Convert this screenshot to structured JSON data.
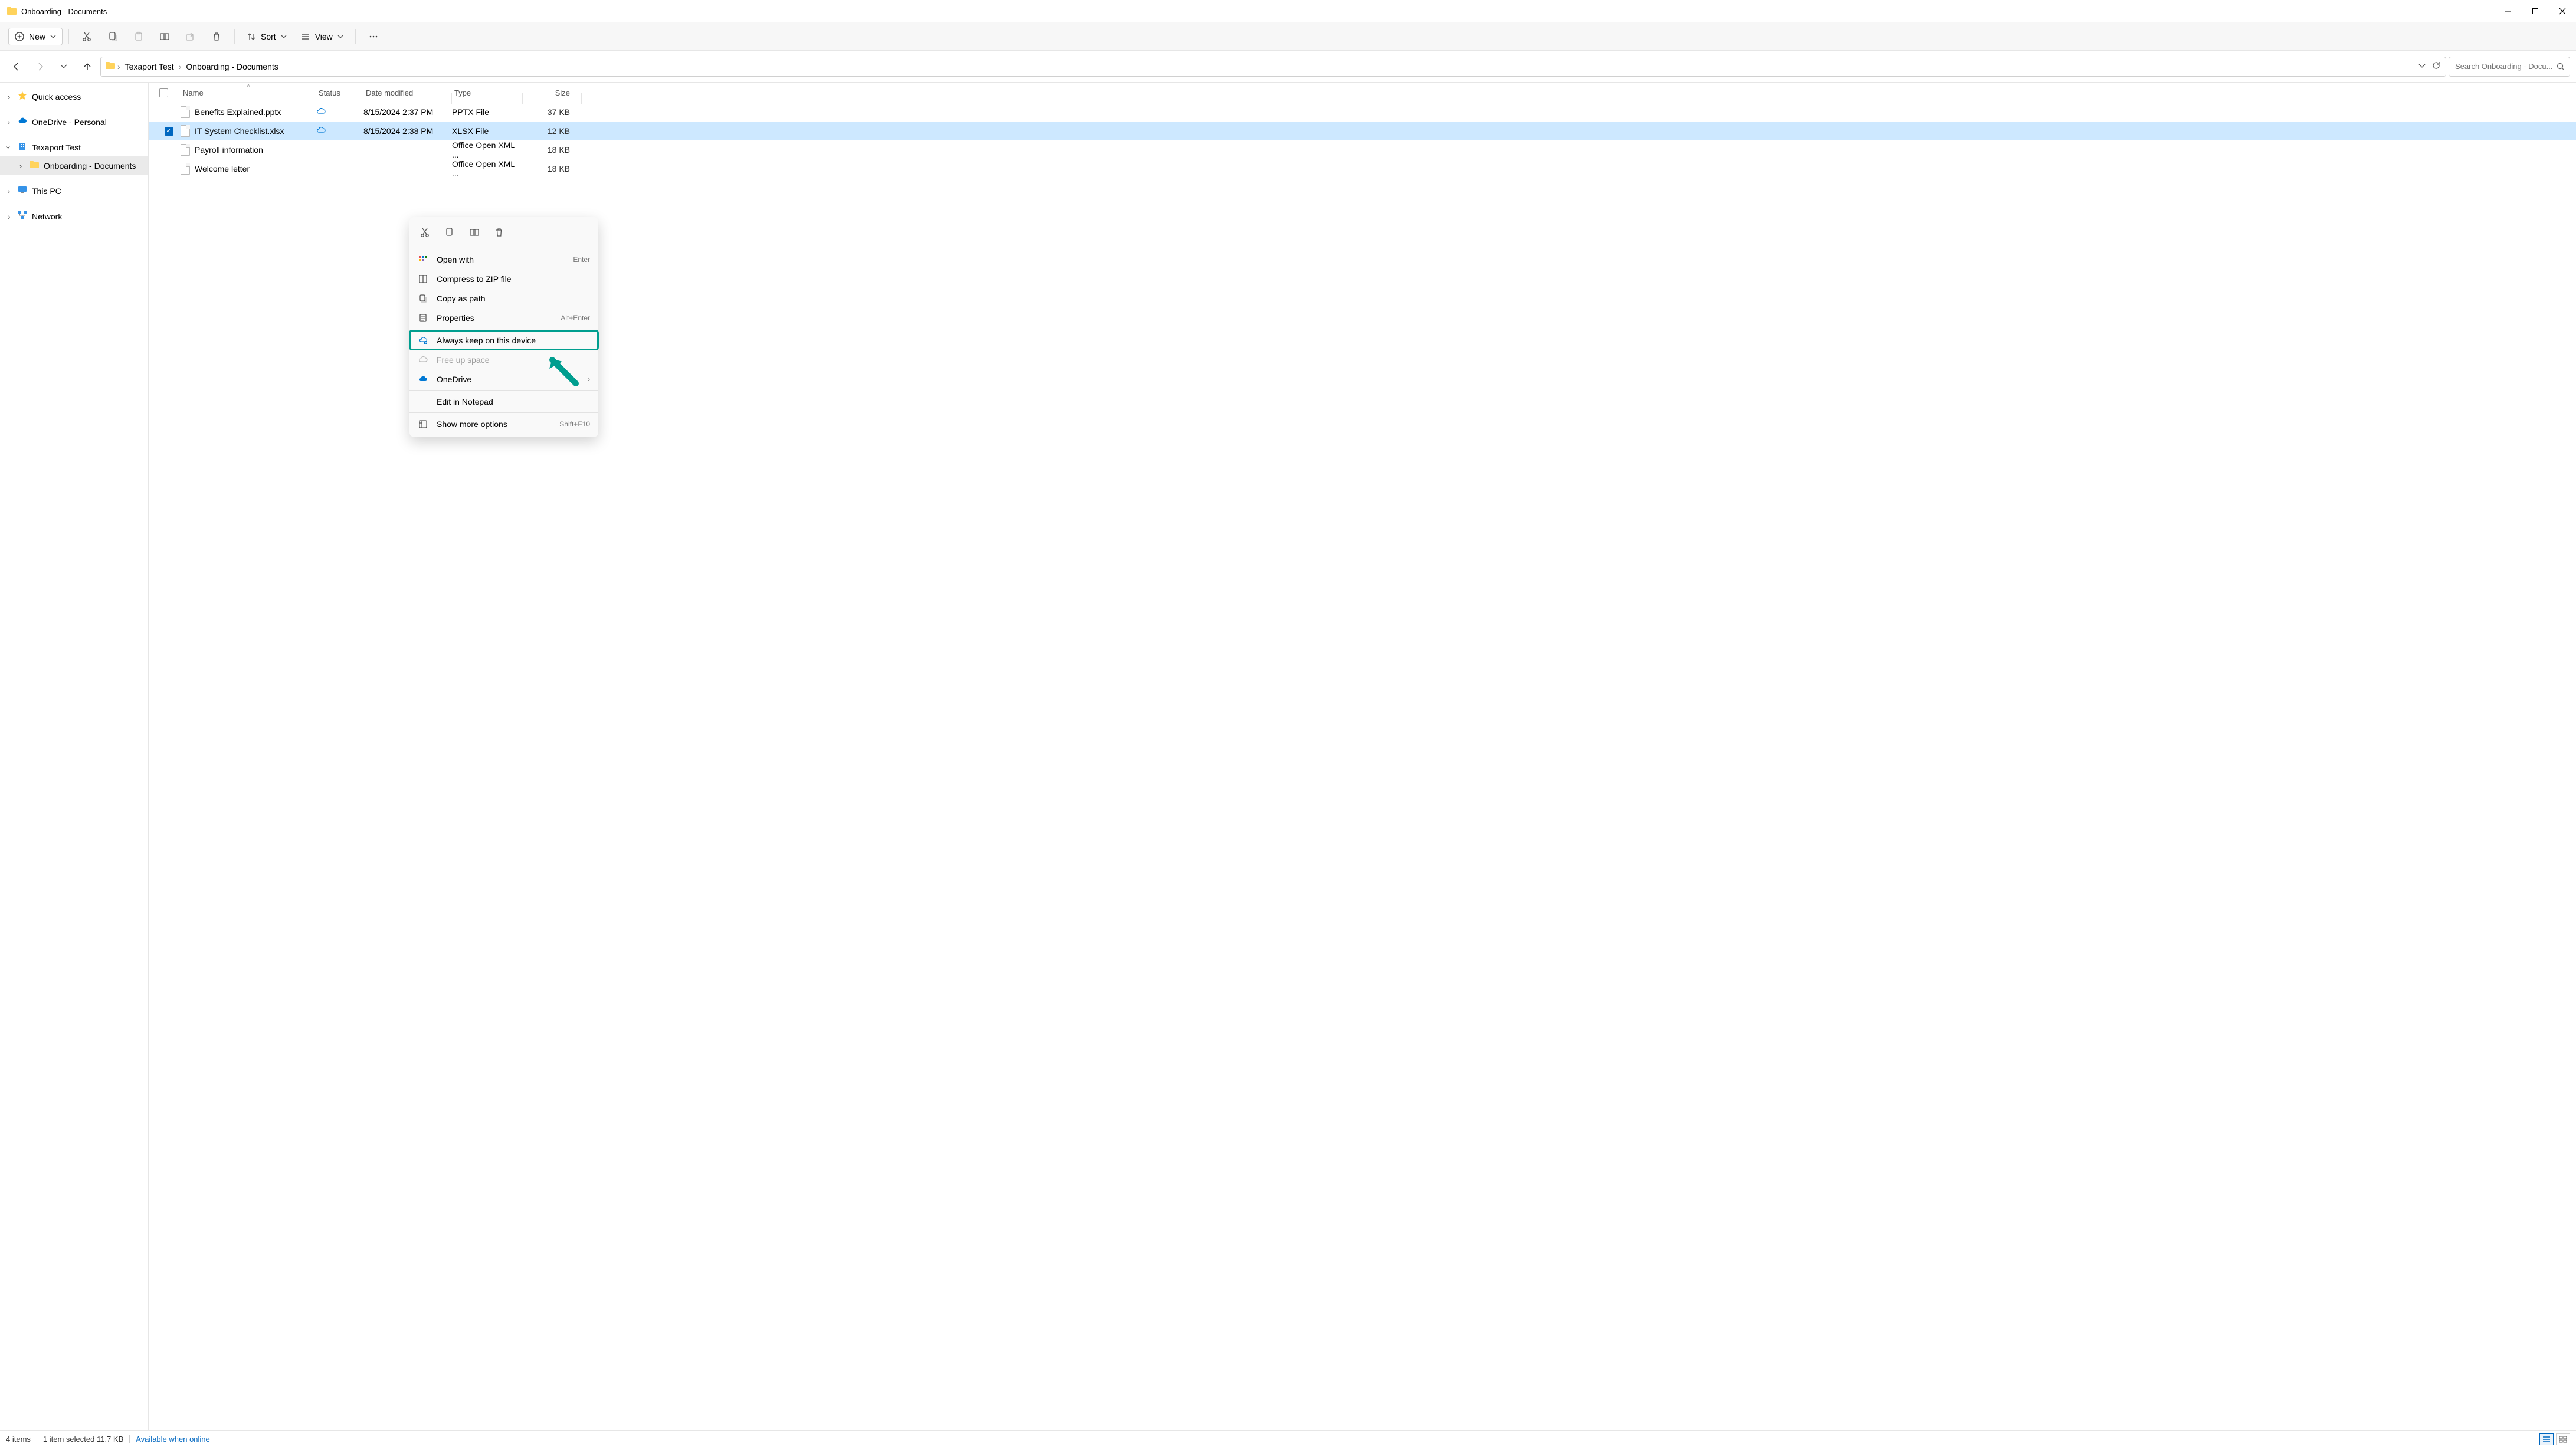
{
  "window": {
    "title": "Onboarding - Documents"
  },
  "toolbar": {
    "new_label": "New",
    "sort_label": "Sort",
    "view_label": "View"
  },
  "breadcrumb": {
    "root": "Texaport Test",
    "folder": "Onboarding - Documents"
  },
  "search": {
    "placeholder": "Search Onboarding - Docu..."
  },
  "sidebar": {
    "items": [
      {
        "label": "Quick access"
      },
      {
        "label": "OneDrive - Personal"
      },
      {
        "label": "Texaport Test"
      },
      {
        "label": "Onboarding - Documents"
      },
      {
        "label": "This PC"
      },
      {
        "label": "Network"
      }
    ]
  },
  "columns": {
    "name": "Name",
    "status": "Status",
    "modified": "Date modified",
    "type": "Type",
    "size": "Size"
  },
  "files": [
    {
      "name": "Benefits Explained.pptx",
      "modified": "8/15/2024 2:37 PM",
      "type": "PPTX File",
      "size": "37 KB",
      "selected": false,
      "status": "cloud"
    },
    {
      "name": "IT System Checklist.xlsx",
      "modified": "8/15/2024 2:38 PM",
      "type": "XLSX File",
      "size": "12 KB",
      "selected": true,
      "status": "cloud"
    },
    {
      "name": "Payroll information",
      "modified": "",
      "type": "Office Open XML ...",
      "size": "18 KB",
      "selected": false,
      "status": ""
    },
    {
      "name": "Welcome letter",
      "modified": "",
      "type": "Office Open XML ...",
      "size": "18 KB",
      "selected": false,
      "status": ""
    }
  ],
  "context_menu": {
    "open_with": "Open with",
    "open_with_hint": "Enter",
    "compress": "Compress to ZIP file",
    "copy_path": "Copy as path",
    "properties": "Properties",
    "properties_hint": "Alt+Enter",
    "always_keep": "Always keep on this device",
    "free_up": "Free up space",
    "onedrive": "OneDrive",
    "edit_notepad": "Edit in Notepad",
    "show_more": "Show more options",
    "show_more_hint": "Shift+F10"
  },
  "statusbar": {
    "count": "4 items",
    "selected": "1 item selected  11.7 KB",
    "availability": "Available when online"
  }
}
